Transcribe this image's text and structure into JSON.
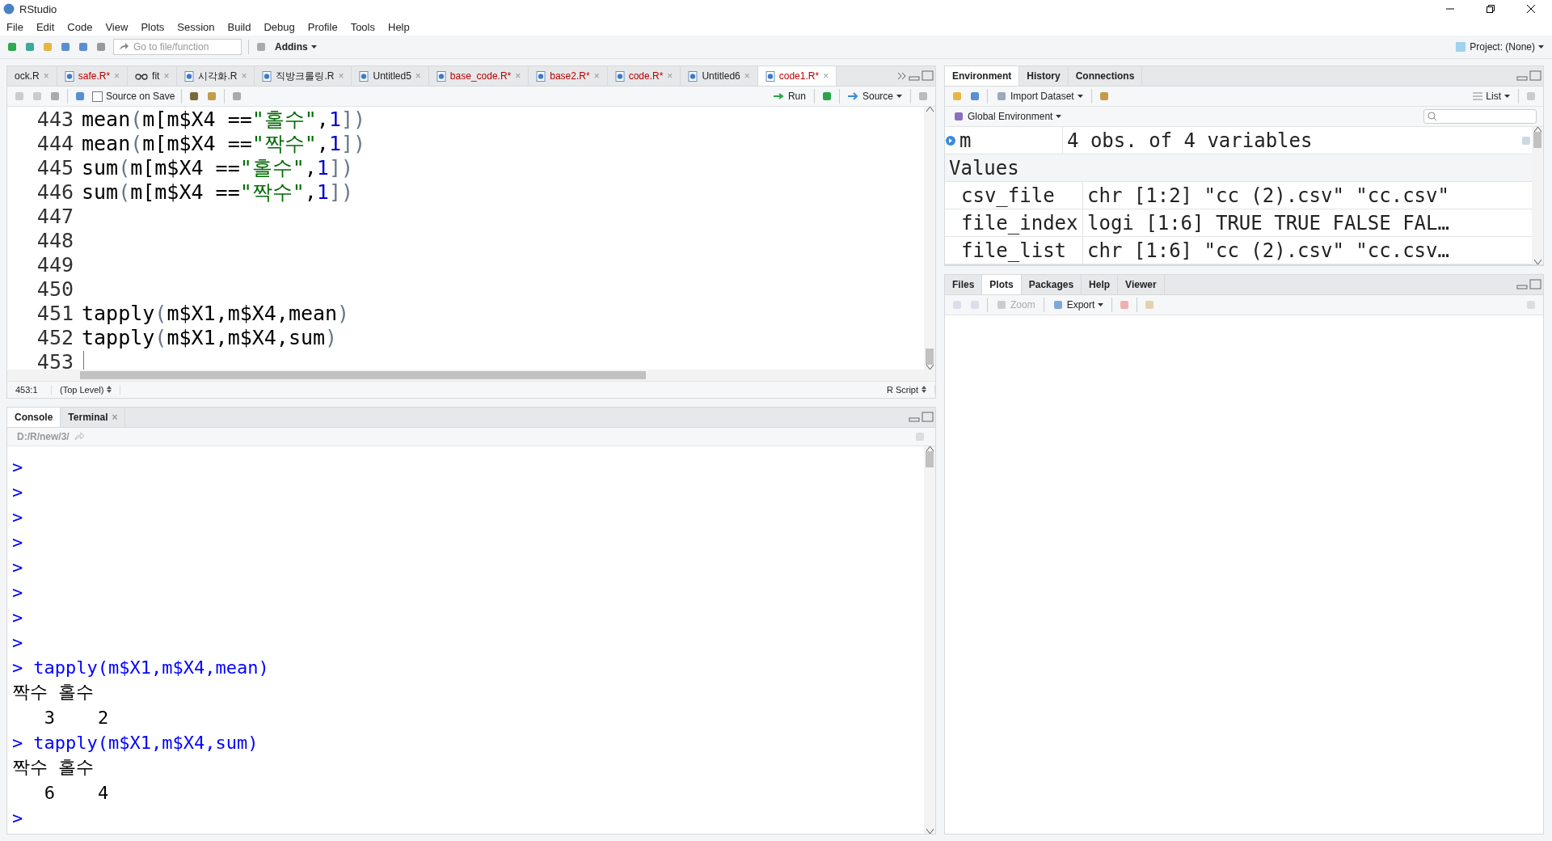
{
  "window": {
    "title": "RStudio"
  },
  "menu": [
    "File",
    "Edit",
    "Code",
    "View",
    "Plots",
    "Session",
    "Build",
    "Debug",
    "Profile",
    "Tools",
    "Help"
  ],
  "toolbar": {
    "goto_placeholder": "Go to file/function",
    "addins": "Addins",
    "project": "Project: (None)"
  },
  "editor": {
    "tabs": [
      {
        "label": "ock.R",
        "kind": "cut",
        "modified": false,
        "selected": false,
        "close": "×"
      },
      {
        "label": "safe.R*",
        "kind": "script",
        "modified": true,
        "selected": false,
        "close": "×"
      },
      {
        "label": "fit",
        "kind": "data",
        "modified": false,
        "selected": false,
        "close": "×"
      },
      {
        "label": "시각화.R",
        "kind": "script",
        "modified": false,
        "selected": false,
        "close": "×"
      },
      {
        "label": "직방크롤링.R",
        "kind": "script",
        "modified": false,
        "selected": false,
        "close": "×"
      },
      {
        "label": "Untitled5",
        "kind": "script",
        "modified": false,
        "selected": false,
        "close": "×"
      },
      {
        "label": "base_code.R*",
        "kind": "script",
        "modified": true,
        "selected": false,
        "close": "×"
      },
      {
        "label": "base2.R*",
        "kind": "script",
        "modified": true,
        "selected": false,
        "close": "×"
      },
      {
        "label": "code.R*",
        "kind": "script",
        "modified": true,
        "selected": false,
        "close": "×"
      },
      {
        "label": "Untitled6",
        "kind": "script",
        "modified": false,
        "selected": false,
        "close": "×"
      },
      {
        "label": "code1.R*",
        "kind": "script",
        "modified": true,
        "selected": true,
        "close": "×"
      }
    ],
    "source_on_save": {
      "label": "Source on Save",
      "checked": false
    },
    "run": "Run",
    "source": "Source",
    "lines": [
      {
        "number": "443",
        "tokens": [
          {
            "text": "mean",
            "kind": "plain"
          },
          {
            "text": "(",
            "kind": "paren"
          },
          {
            "text": "m[m$X4 ==",
            "kind": "plain"
          },
          {
            "text": "\"홀수\"",
            "kind": "string"
          },
          {
            "text": ",",
            "kind": "plain"
          },
          {
            "text": "1",
            "kind": "number"
          },
          {
            "text": "])",
            "kind": "paren"
          }
        ]
      },
      {
        "number": "444",
        "tokens": [
          {
            "text": "mean",
            "kind": "plain"
          },
          {
            "text": "(",
            "kind": "paren"
          },
          {
            "text": "m[m$X4 ==",
            "kind": "plain"
          },
          {
            "text": "\"짝수\"",
            "kind": "string"
          },
          {
            "text": ",",
            "kind": "plain"
          },
          {
            "text": "1",
            "kind": "number"
          },
          {
            "text": "])",
            "kind": "paren"
          }
        ]
      },
      {
        "number": "445",
        "tokens": [
          {
            "text": "sum",
            "kind": "plain"
          },
          {
            "text": "(",
            "kind": "paren"
          },
          {
            "text": "m[m$X4 ==",
            "kind": "plain"
          },
          {
            "text": "\"홀수\"",
            "kind": "string"
          },
          {
            "text": ",",
            "kind": "plain"
          },
          {
            "text": "1",
            "kind": "number"
          },
          {
            "text": "])",
            "kind": "paren"
          }
        ]
      },
      {
        "number": "446",
        "tokens": [
          {
            "text": "sum",
            "kind": "plain"
          },
          {
            "text": "(",
            "kind": "paren"
          },
          {
            "text": "m[m$X4 ==",
            "kind": "plain"
          },
          {
            "text": "\"짝수\"",
            "kind": "string"
          },
          {
            "text": ",",
            "kind": "plain"
          },
          {
            "text": "1",
            "kind": "number"
          },
          {
            "text": "])",
            "kind": "paren"
          }
        ]
      },
      {
        "number": "447"
      },
      {
        "number": "448"
      },
      {
        "number": "449"
      },
      {
        "number": "450"
      },
      {
        "number": "451",
        "tokens": [
          {
            "text": "tapply",
            "kind": "plain"
          },
          {
            "text": "(",
            "kind": "paren"
          },
          {
            "text": "m$X1,m$X4,mean",
            "kind": "plain"
          },
          {
            "text": ")",
            "kind": "paren"
          }
        ]
      },
      {
        "number": "452",
        "tokens": [
          {
            "text": "tapply",
            "kind": "plain"
          },
          {
            "text": "(",
            "kind": "paren"
          },
          {
            "text": "m$X1,m$X4,sum",
            "kind": "plain"
          },
          {
            "text": ")",
            "kind": "paren"
          }
        ]
      },
      {
        "number": "453",
        "cursor": true
      }
    ],
    "status": {
      "position": "453:1",
      "scope": "(Top Level)",
      "filetype": "R Script"
    }
  },
  "console": {
    "tabs": [
      {
        "label": "Console",
        "selected": true
      },
      {
        "label": "Terminal",
        "selected": false,
        "close": "×"
      }
    ],
    "path": "D:/R/new/3/",
    "lines": [
      {
        "kind": "prompt",
        "prompt": ">"
      },
      {
        "kind": "prompt",
        "prompt": ">"
      },
      {
        "kind": "prompt",
        "prompt": ">"
      },
      {
        "kind": "prompt",
        "prompt": ">"
      },
      {
        "kind": "prompt",
        "prompt": ">"
      },
      {
        "kind": "prompt",
        "prompt": ">"
      },
      {
        "kind": "prompt",
        "prompt": ">"
      },
      {
        "kind": "prompt",
        "prompt": ">"
      },
      {
        "kind": "prompt",
        "prompt": ">",
        "text": "tapply(m$X1,m$X4,mean)"
      },
      {
        "kind": "output",
        "text": "짝수 홀수"
      },
      {
        "kind": "output",
        "text": "   3    2"
      },
      {
        "kind": "prompt",
        "prompt": ">",
        "text": "tapply(m$X1,m$X4,sum)"
      },
      {
        "kind": "output",
        "text": "짝수 홀수"
      },
      {
        "kind": "output",
        "text": "   6    4"
      },
      {
        "kind": "prompt",
        "prompt": ">"
      }
    ]
  },
  "environment": {
    "tabs": [
      {
        "label": "Environment",
        "selected": true
      },
      {
        "label": "History",
        "selected": false
      },
      {
        "label": "Connections",
        "selected": false
      }
    ],
    "import": "Import Dataset",
    "view": "List",
    "scope": "Global Environment",
    "data": [
      {
        "name": "m",
        "value": "4 obs. of 4 variables"
      }
    ],
    "section": "Values",
    "values": [
      {
        "name": "csv_file",
        "value": "chr [1:2] \"cc (2).csv\" \"cc.csv\""
      },
      {
        "name": "file_index",
        "value": "logi [1:6] TRUE TRUE FALSE FAL…"
      },
      {
        "name": "file_list",
        "value": "chr [1:6] \"cc (2).csv\" \"cc.csv…"
      }
    ]
  },
  "files": {
    "tabs": [
      {
        "label": "Files",
        "selected": false
      },
      {
        "label": "Plots",
        "selected": true
      },
      {
        "label": "Packages",
        "selected": false
      },
      {
        "label": "Help",
        "selected": false
      },
      {
        "label": "Viewer",
        "selected": false
      }
    ],
    "zoom": "Zoom",
    "export": "Export"
  }
}
